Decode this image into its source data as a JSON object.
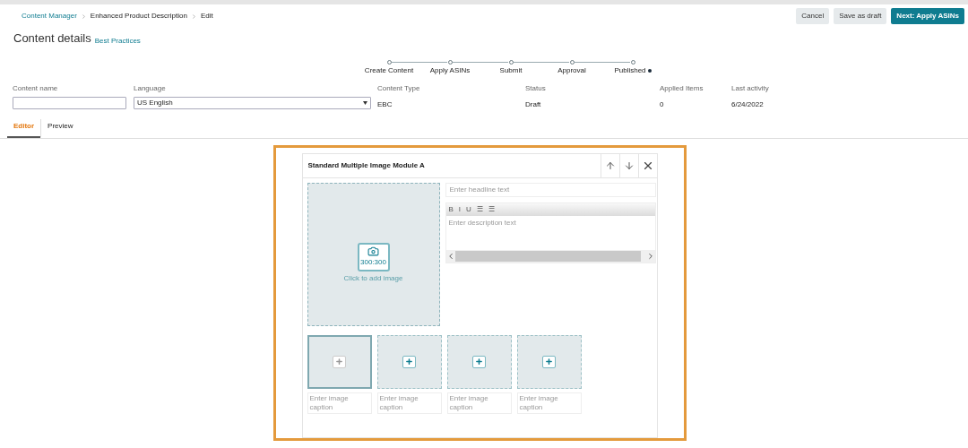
{
  "breadcrumb": [
    "Content Manager",
    "Enhanced Product Description",
    "Edit"
  ],
  "actions": [
    {
      "label": "Cancel",
      "kind": "secondary"
    },
    {
      "label": "Save as draft",
      "kind": "secondary"
    },
    {
      "label": "Next: Apply ASINs",
      "kind": "primary"
    }
  ],
  "title": "Content details",
  "title_link": "Best Practices",
  "steps": [
    "Create Content",
    "Apply ASINs",
    "Submit",
    "Approval",
    "Published"
  ],
  "fields": {
    "content_name": {
      "label": "Content name"
    },
    "language": {
      "label": "Language",
      "value": "US English"
    },
    "info": [
      {
        "label": "Content Type",
        "value": "EBC"
      },
      {
        "label": "Status",
        "value": "Draft"
      },
      {
        "label": "Applied Items",
        "value": "0"
      },
      {
        "label": "Last activity",
        "value": "6/24/2022"
      }
    ]
  },
  "tabs": [
    {
      "label": "Editor",
      "selected": true
    },
    {
      "label": "Preview",
      "selected": false
    }
  ],
  "module": {
    "title": "Standard Multiple Image Module A",
    "main_image": {
      "size": "300:300",
      "hint": "Click to add image"
    },
    "headline": {
      "placeholder": "Enter headline text"
    },
    "toolbar": [
      "B",
      "I",
      "U",
      "☰",
      "☰"
    ],
    "description": {
      "placeholder": "Enter description text"
    },
    "thumbnails": [
      {
        "selected": true,
        "caption": {
          "placeholder": "Enter image caption"
        }
      },
      {
        "selected": false,
        "caption": {
          "placeholder": "Enter image caption"
        }
      },
      {
        "selected": false,
        "caption": {
          "placeholder": "Enter image caption"
        }
      },
      {
        "selected": false,
        "caption": {
          "placeholder": "Enter image caption"
        }
      }
    ]
  }
}
